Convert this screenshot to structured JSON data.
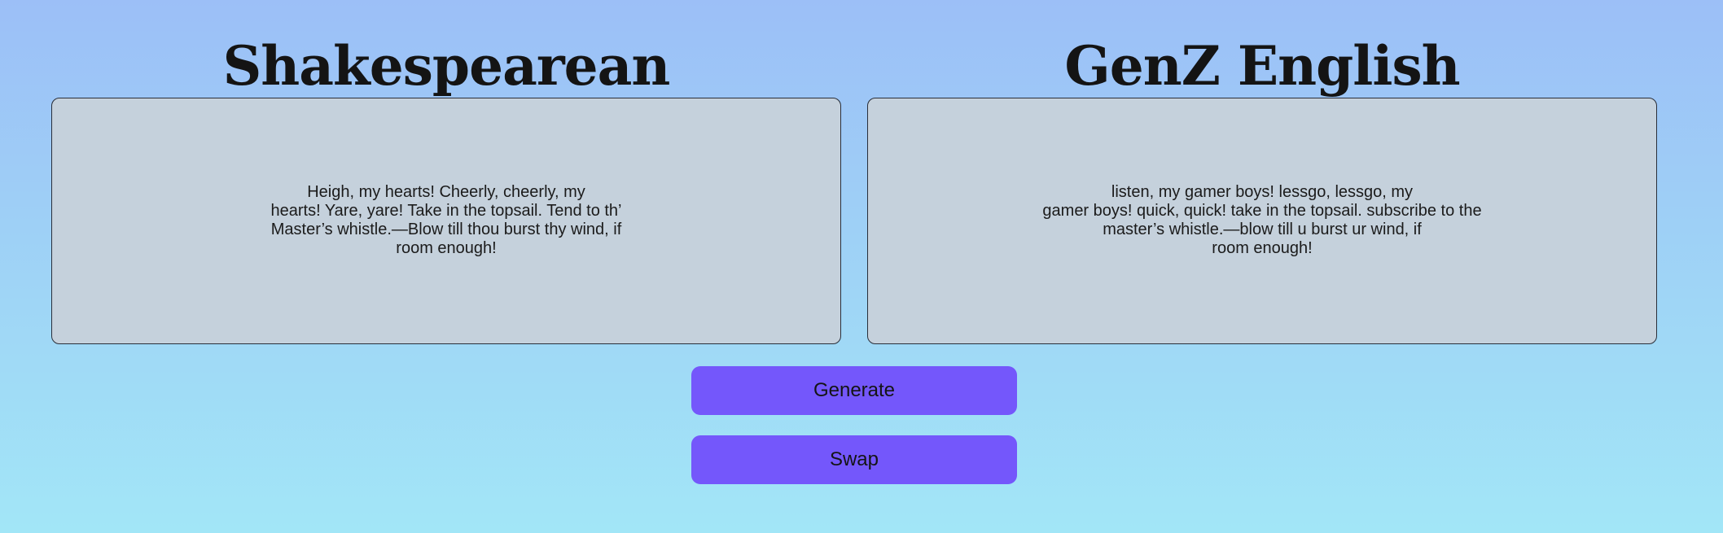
{
  "left_panel": {
    "title": "Shakespearean",
    "lines": [
      "Heigh, my hearts! Cheerly, cheerly, my",
      "hearts! Yare, yare! Take in the topsail. Tend to th’",
      "Master’s whistle.—Blow till thou burst thy wind, if",
      "room enough!"
    ]
  },
  "right_panel": {
    "title": "GenZ English",
    "lines": [
      "listen, my gamer boys! lessgo, lessgo, my",
      "gamer boys! quick, quick! take in the topsail. subscribe to the",
      "master’s whistle.—blow till u burst ur wind, if",
      "room enough!"
    ]
  },
  "buttons": {
    "generate_label": "Generate",
    "swap_label": "Swap"
  },
  "colors": {
    "button_bg": "#7457fb",
    "textbox_bg": "#c5d1dc",
    "background_top": "#9cbff7",
    "background_bottom": "#a2e6f7"
  }
}
